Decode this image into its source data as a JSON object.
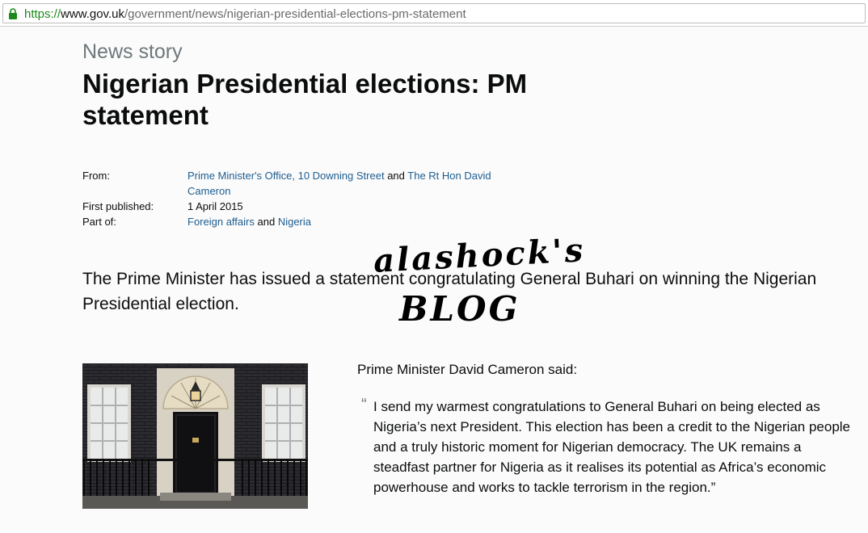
{
  "browser": {
    "url_scheme": "https://",
    "url_host": "www.gov.uk",
    "url_path": "/government/news/nigerian-presidential-elections-pm-statement"
  },
  "page": {
    "kicker": "News story",
    "title": "Nigerian Presidential elections: PM statement"
  },
  "meta": {
    "from_label": "From:",
    "from_link1": "Prime Minister's Office, 10 Downing Street",
    "from_and": "and",
    "from_link2": "The Rt Hon David Cameron",
    "published_label": "First published:",
    "published_value": "1 April 2015",
    "partof_label": "Part of:",
    "partof_link1": "Foreign affairs",
    "partof_and": "and",
    "partof_link2": "Nigeria"
  },
  "lead": "The Prime Minister has issued a statement congratulating General Buhari on winning the Nigerian Presidential election.",
  "watermark": {
    "line1": "alashock's",
    "line2": "BLOG"
  },
  "body": {
    "said": "Prime Minister David Cameron said:",
    "quote_mark": "“",
    "quote": "I send my warmest congratulations to General Buhari on being elected as Nigeria’s next President. This election has been a credit to the Nigerian people and a truly historic moment for Nigerian democracy. The UK remains a steadfast partner for Nigeria as it realises its potential as Africa’s economic powerhouse and works to tackle terrorism in the region.”"
  }
}
